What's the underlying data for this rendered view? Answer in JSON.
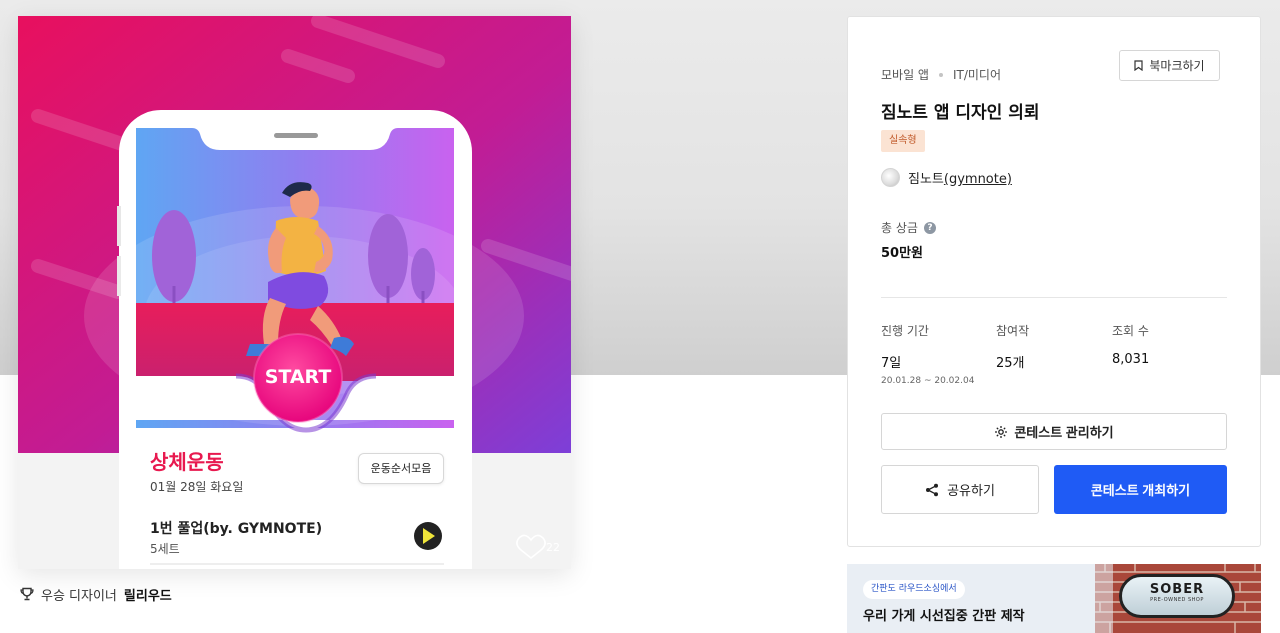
{
  "artwork": {
    "start_label": "START",
    "workout_title": "상체운동",
    "workout_date": "01월 28일 화요일",
    "order_button": "운동순서모음",
    "exercise_name": "1번 풀업(by. GYMNOTE)",
    "exercise_sets": "5세트",
    "like_count": "22"
  },
  "winner": {
    "label": "우승 디자이너",
    "name": "릴리우드"
  },
  "contest": {
    "category": "모바일 앱",
    "subcategory": "IT/미디어",
    "bookmark_label": "북마크하기",
    "title": "짐노트 앱 디자인 의뢰",
    "badge": "실속형",
    "host_name": "짐노트",
    "host_handle": "(gymnote)",
    "prize_label": "총 상금",
    "prize_help": "?",
    "prize_value": "50만원",
    "stats": {
      "period_label": "진행 기간",
      "period_value": "7일",
      "period_range": "20.01.28 ~ 20.02.04",
      "participants_label": "참여작",
      "participants_value": "25개",
      "views_label": "조회 수",
      "views_value": "8,031"
    },
    "manage_label": "콘테스트 관리하기",
    "share_label": "공유하기",
    "host_contest_label": "콘테스트 개최하기"
  },
  "ad": {
    "pill": "간판도 라우드소싱에서",
    "headline": "우리 가게 시선집중 간판 제작",
    "sign_brand": "SOBER",
    "sign_tag": "PRE-OWNED SHOP"
  },
  "colors": {
    "primary": "#1f5bf5",
    "badge_bg": "#fbe3d3",
    "badge_text": "#c05a2a",
    "accent_pink": "#e8194f"
  }
}
